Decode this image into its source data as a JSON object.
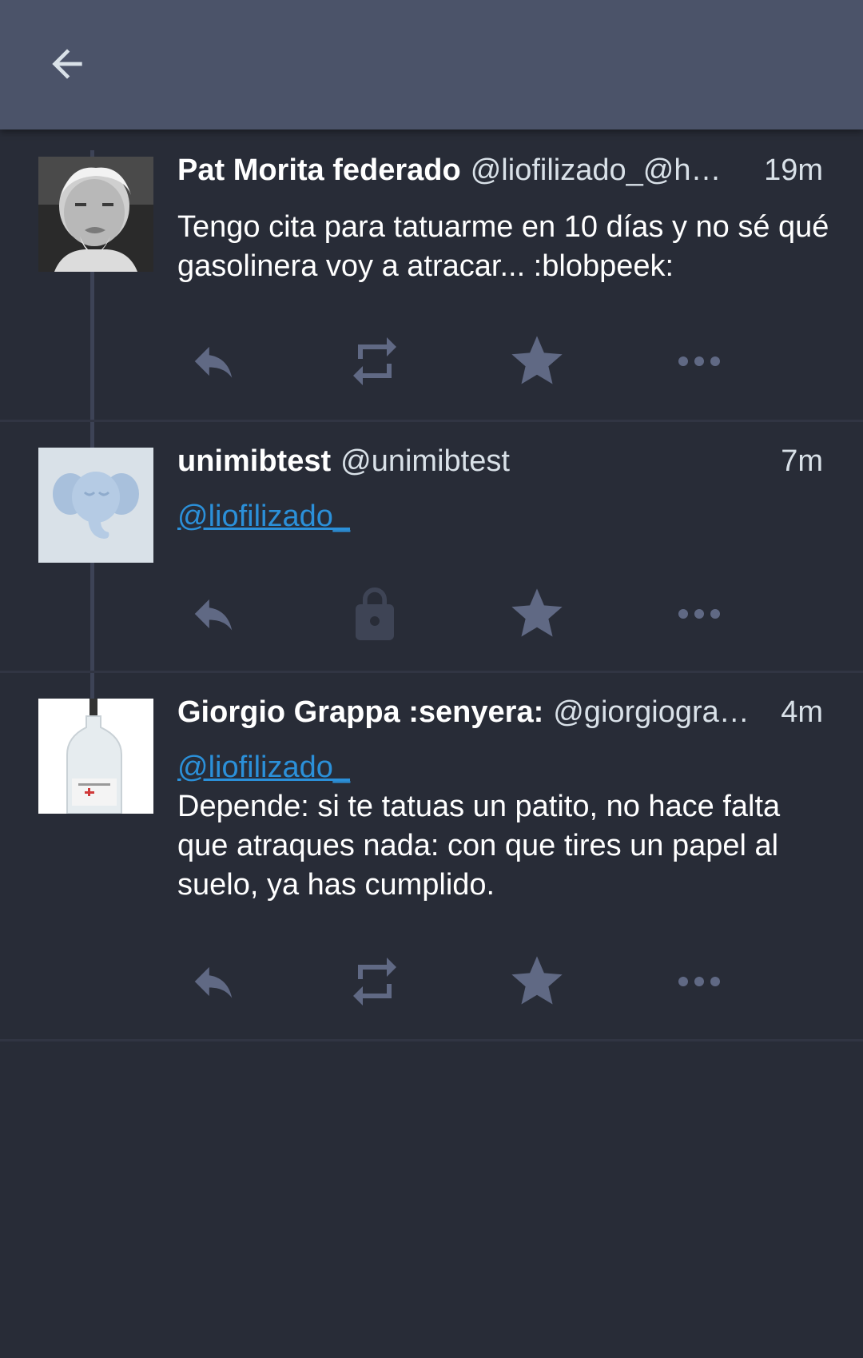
{
  "header": {
    "back_icon": "arrow-left-icon"
  },
  "colors": {
    "background": "#282c37",
    "topbar": "#4b5369",
    "action_icon": "#606984",
    "mention": "#2b90d9"
  },
  "statuses": [
    {
      "display_name": "Pat Morita federado",
      "acct": "@liofilizado_@h…",
      "time": "19m",
      "content": "Tengo cita para tatuarme en 10 días y no sé qué gasolinera voy a atracar... :blobpeek:",
      "avatar": "portrait-avatar",
      "actions": [
        "reply-icon",
        "boost-icon",
        "favourite-icon",
        "more-icon"
      ]
    },
    {
      "display_name": "unimibtest",
      "acct": "@unimibtest",
      "time": "7m",
      "mention": "@liofilizado_",
      "avatar": "default-elephant-avatar",
      "actions": [
        "reply-icon",
        "lock-icon",
        "favourite-icon",
        "more-icon"
      ]
    },
    {
      "display_name": "Giorgio Grappa :senyera:",
      "acct": "@giorgiogra…",
      "time": "4m",
      "mention": "@liofilizado_",
      "content": "Depende: si te tatuas un patito, no hace falta que atraques nada: con que tires un papel al suelo, ya has cumplido.",
      "avatar": "bottle-avatar",
      "actions": [
        "reply-icon",
        "boost-icon",
        "favourite-icon",
        "more-icon"
      ]
    }
  ]
}
